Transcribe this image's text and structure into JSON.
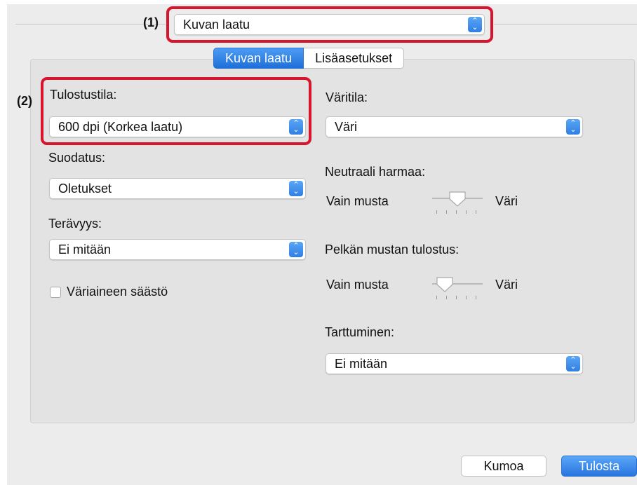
{
  "top_popup": {
    "value": "Kuvan laatu"
  },
  "callouts": {
    "one": "(1)",
    "two": "(2)"
  },
  "tabs": [
    {
      "label": "Kuvan laatu",
      "active": true
    },
    {
      "label": "Lisäasetukset",
      "active": false
    }
  ],
  "left": {
    "print_mode": {
      "label": "Tulostustila:",
      "value": "600 dpi (Korkea laatu)"
    },
    "filter": {
      "label": "Suodatus:",
      "value": "Oletukset"
    },
    "sharpness": {
      "label": "Terävyys:",
      "value": "Ei mitään"
    },
    "toner_save": {
      "label": "Väriaineen säästö",
      "checked": false
    }
  },
  "right": {
    "color_mode": {
      "label": "Väritila:",
      "value": "Väri"
    },
    "neutral_gray": {
      "label": "Neutraali harmaa:",
      "min_label": "Vain musta",
      "max_label": "Väri",
      "level": 0.5
    },
    "pure_black": {
      "label": "Pelkän mustan tulostus:",
      "min_label": "Vain musta",
      "max_label": "Väri",
      "level": 0.25
    },
    "trapping": {
      "label": "Tarttuminen:",
      "value": "Ei mitään"
    }
  },
  "footer": {
    "cancel_label": "Kumoa",
    "print_label": "Tulosta"
  },
  "colors": {
    "accent": "#2f7fe3",
    "callout_box": "#d8152f"
  }
}
